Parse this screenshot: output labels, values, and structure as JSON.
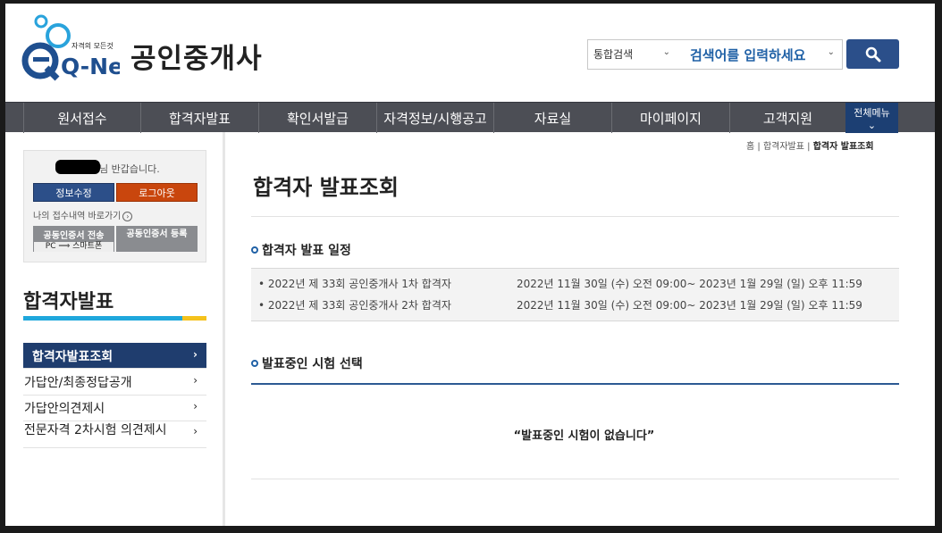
{
  "brand": {
    "logo_tagline": "자격의 모든것",
    "logo_text": "Q-Net",
    "site_title": "공인중개사"
  },
  "search": {
    "scope": "통합검색",
    "placeholder": "검색어를 입력하세요"
  },
  "nav": {
    "items": [
      {
        "label": "원서접수"
      },
      {
        "label": "합격자발표"
      },
      {
        "label": "확인서발급"
      },
      {
        "label": "자격정보/시행공고"
      },
      {
        "label": "자료실"
      },
      {
        "label": "마이페이지"
      },
      {
        "label": "고객지원"
      }
    ],
    "all_menu": "전체메뉴"
  },
  "login": {
    "welcome": "님 반갑습니다.",
    "edit_info": "정보수정",
    "logout": "로그아웃",
    "my_applications": "나의 접수내역 바로가기",
    "cert_send_line1": "공동인증서 전송",
    "cert_send_line2": "PC ⟹ 스마트폰",
    "cert_register": "공동인증서 등록"
  },
  "lnb": {
    "title": "합격자발표",
    "items": [
      {
        "label": "합격자발표조회",
        "active": true
      },
      {
        "label": "가답안/최종정답공개"
      },
      {
        "label": "가답안의견제시"
      },
      {
        "label": "전문자격 2차시험 의견제시"
      }
    ]
  },
  "breadcrumb": {
    "home": "홈",
    "level1": "합격자발표",
    "current": "합격자 발표조회",
    "sep": "|"
  },
  "content": {
    "page_title": "합격자 발표조회",
    "schedule_title": "합격자 발표 일정",
    "schedule": [
      {
        "exam": "2022년 제 33회 공인중개사 1차 합격자",
        "period": "2022년 11월 30일 (수) 오전 09:00~ 2023년 1월 29일 (일) 오후 11:59"
      },
      {
        "exam": "2022년 제 33회 공인중개사 2차 합격자",
        "period": "2022년 11월 30일 (수) 오전 09:00~ 2023년 1월 29일 (일) 오후 11:59"
      }
    ],
    "exam_select_title": "발표중인 시험 선택",
    "empty_message": "“발표중인 시험이 없습니다”"
  }
}
